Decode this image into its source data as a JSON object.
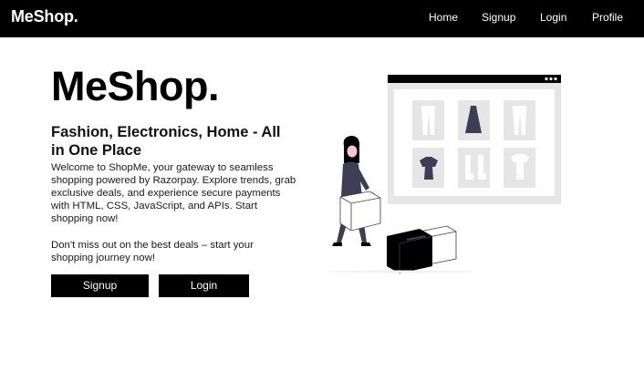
{
  "navbar": {
    "brand": "MeShop.",
    "links": [
      "Home",
      "Signup",
      "Login",
      "Profile"
    ]
  },
  "hero": {
    "title": "MeShop.",
    "subtitle": "Fashion, Electronics, Home - All in One Place",
    "paragraph1": "Welcome to ShopMe, your gateway to seamless shopping powered by Razorpay. Explore trends, grab exclusive deals, and experience secure payments with HTML, CSS, JavaScript, and APIs. Start shopping now!",
    "paragraph2": "Don't miss out on the best deals – start your shopping journey now!",
    "buttons": {
      "signup": "Signup",
      "login": "Login"
    }
  },
  "illustration": {
    "name": "online-shopping-illustration",
    "colors": {
      "frame": "#e6e6e6",
      "accent": "#3f3d56",
      "dark": "#000000",
      "skin": "#f9c5c9"
    }
  }
}
